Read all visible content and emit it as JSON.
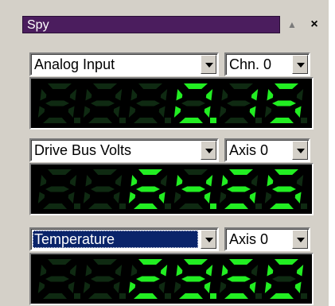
{
  "window": {
    "title": "Spy",
    "pin_icon": "triangle-up-icon",
    "close_label": "×"
  },
  "rows": [
    {
      "signal": "Analog Input",
      "channel": "Chn. 0",
      "reading": "0.15",
      "focused": false
    },
    {
      "signal": "Drive Bus Volts",
      "channel": "Axis 0",
      "reading": "64.55",
      "focused": false
    },
    {
      "signal": "Temperature",
      "channel": "Axis 0",
      "reading": "29.50",
      "focused": true
    }
  ],
  "colors": {
    "digit_on": "#22ee22",
    "digit_off": "#0f2a12",
    "panel": "#d4d0c8",
    "title_bar": "#4b1d5e"
  }
}
